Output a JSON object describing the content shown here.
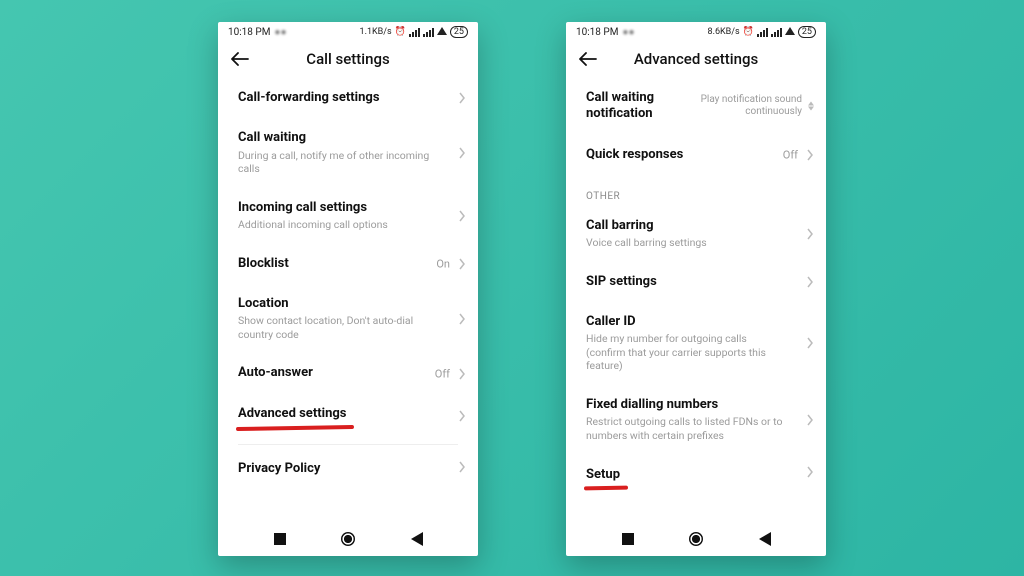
{
  "status": {
    "time": "10:18 PM",
    "speed_left": "1.1KB/s",
    "speed_right": "8.6KB/s",
    "battery": "25"
  },
  "left": {
    "title": "Call settings",
    "items": {
      "cfwd": {
        "title": "Call-forwarding settings"
      },
      "cwait": {
        "title": "Call waiting",
        "sub": "During a call, notify me of other incoming calls"
      },
      "incoming": {
        "title": "Incoming call settings",
        "sub": "Additional incoming call options"
      },
      "blocklist": {
        "title": "Blocklist",
        "value": "On"
      },
      "location": {
        "title": "Location",
        "sub": "Show contact location, Don't auto-dial country code"
      },
      "autoans": {
        "title": "Auto-answer",
        "value": "Off"
      },
      "advanced": {
        "title": "Advanced settings"
      },
      "privacy": {
        "title": "Privacy Policy"
      }
    }
  },
  "right": {
    "title": "Advanced settings",
    "section_other": "OTHER",
    "items": {
      "cwn": {
        "title": "Call waiting notification",
        "value": "Play notification sound continuously"
      },
      "qr": {
        "title": "Quick responses",
        "value": "Off"
      },
      "barring": {
        "title": "Call barring",
        "sub": "Voice call barring settings"
      },
      "sip": {
        "title": "SIP settings"
      },
      "cid": {
        "title": "Caller ID",
        "sub": "Hide my number for outgoing calls (confirm that your carrier supports this feature)"
      },
      "fdn": {
        "title": "Fixed dialling numbers",
        "sub": "Restrict outgoing calls to listed FDNs or to numbers with certain prefixes"
      },
      "setup": {
        "title": "Setup"
      }
    }
  }
}
